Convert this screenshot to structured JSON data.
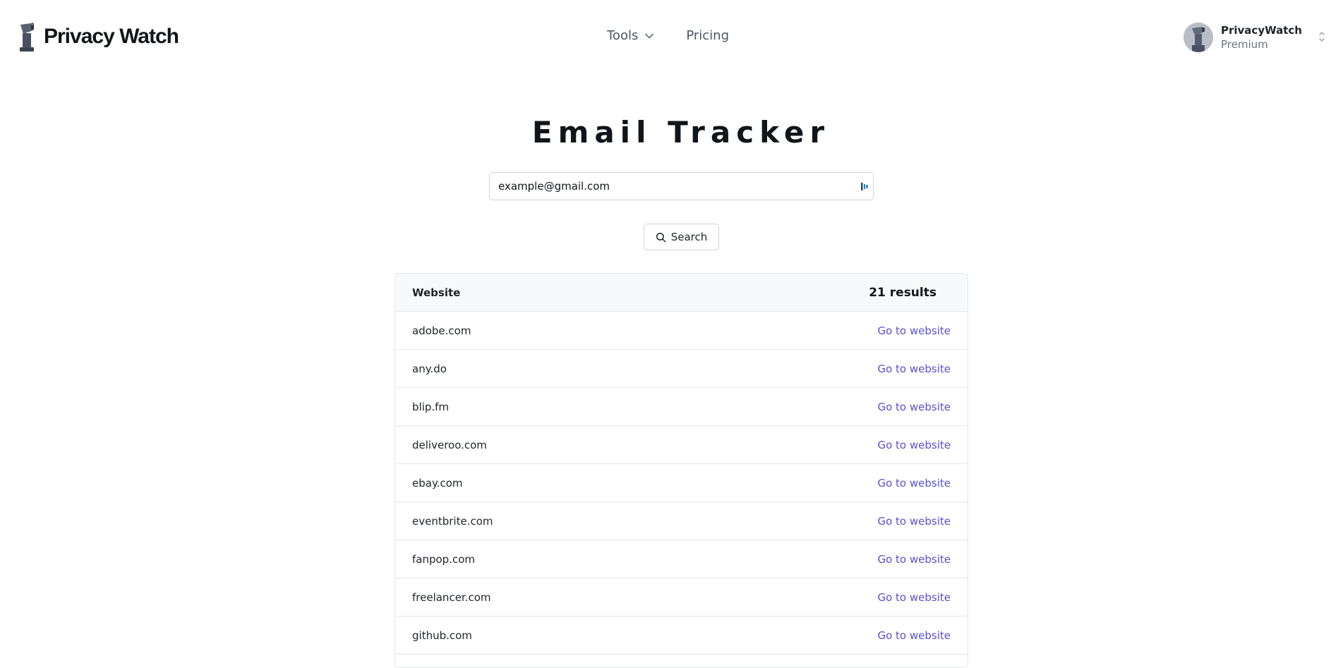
{
  "header": {
    "brand": "Privacy Watch",
    "nav": {
      "tools_label": "Tools",
      "pricing_label": "Pricing"
    },
    "user": {
      "name": "PrivacyWatch",
      "plan": "Premium"
    }
  },
  "main": {
    "title": "Email Tracker",
    "search": {
      "value": "example@gmail.com",
      "button_label": "Search"
    },
    "results": {
      "column_header": "Website",
      "count_label": "21 results",
      "rows": [
        {
          "site": "adobe.com",
          "link": "Go to website"
        },
        {
          "site": "any.do",
          "link": "Go to website"
        },
        {
          "site": "blip.fm",
          "link": "Go to website"
        },
        {
          "site": "deliveroo.com",
          "link": "Go to website"
        },
        {
          "site": "ebay.com",
          "link": "Go to website"
        },
        {
          "site": "eventbrite.com",
          "link": "Go to website"
        },
        {
          "site": "fanpop.com",
          "link": "Go to website"
        },
        {
          "site": "freelancer.com",
          "link": "Go to website"
        },
        {
          "site": "github.com",
          "link": "Go to website"
        }
      ]
    }
  },
  "colors": {
    "link": "#5b4fcf",
    "border": "#e5e7eb",
    "header_bg": "#f8f9fa"
  }
}
